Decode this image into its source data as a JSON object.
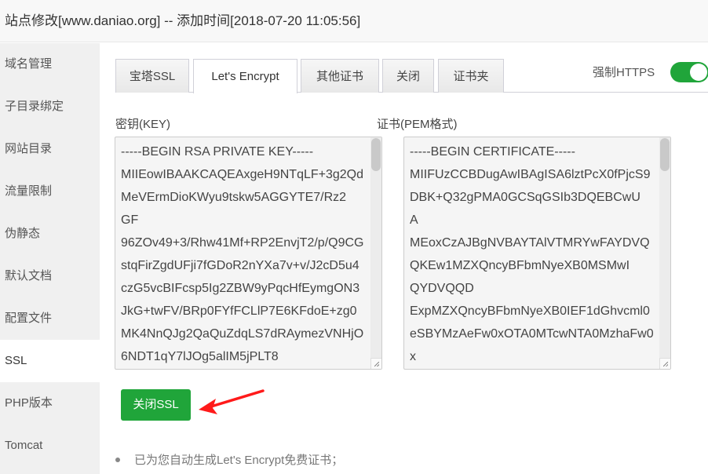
{
  "title_bar": {
    "text": "站点修改[www.daniao.org] -- 添加时间[2018-07-20 11:05:56]"
  },
  "sidebar": {
    "items": [
      {
        "label": "域名管理",
        "active": false
      },
      {
        "label": "子目录绑定",
        "active": false
      },
      {
        "label": "网站目录",
        "active": false
      },
      {
        "label": "流量限制",
        "active": false
      },
      {
        "label": "伪静态",
        "active": false
      },
      {
        "label": "默认文档",
        "active": false
      },
      {
        "label": "配置文件",
        "active": false
      },
      {
        "label": "SSL",
        "active": true
      },
      {
        "label": "PHP版本",
        "active": false
      },
      {
        "label": "Tomcat",
        "active": false
      }
    ]
  },
  "tabs": [
    {
      "label": "宝塔SSL",
      "active": false
    },
    {
      "label": "Let's Encrypt",
      "active": true
    },
    {
      "label": "其他证书",
      "active": false
    },
    {
      "label": "关闭",
      "active": false
    },
    {
      "label": "证书夹",
      "active": false
    }
  ],
  "force_https": {
    "label": "强制HTTPS",
    "enabled": true,
    "color": "#20a53a"
  },
  "key_field": {
    "label": "密钥(KEY)",
    "value": "-----BEGIN RSA PRIVATE KEY-----\nMIIEowIBAAKCAQEAxgeH9NTqLF+3g2QdMeVErmDioKWyu9tskw5AGGYTE7/Rz2\nGF\n96ZOv49+3/Rhw41Mf+RP2EnvjT2/p/Q9CGstqFirZgdUFji7fGDoR2nYXa7v+v/J2cD5u4czG5vcBIFcsp5Ig2ZBW9yPqcHfEymgON3JkG+twFV/BRp0FYfFCLlP7E6KFdoE+zg0MK4NnQJg2QaQuZdqLS7dRAymezVNHjO6NDT1qY7lJOg5alIM5jPLT8"
  },
  "cert_field": {
    "label": "证书(PEM格式)",
    "value": "-----BEGIN CERTIFICATE-----\nMIIFUzCCBDugAwIBAgISA6lztPcX0fPjcS9DBK+Q32gPMA0GCSqGSIb3DQEBCwU\nA\nMEoxCzAJBgNVBAYTAlVTMRYwFAYDVQQKEw1MZXQncyBFbmNyeXB0MSMwI\nQYDVQQD\nExpMZXQncyBFbmNyeXB0IEF1dGhvcml0eSBYMzAeFw0xOTA0MTcwNTA0MzhaFw0x"
  },
  "actions": {
    "close_ssl_label": "关闭SSL",
    "close_ssl_color": "#20a53a"
  },
  "annotation": {
    "arrow_color": "#ff1a1a"
  },
  "tips": [
    "已为您自动生成Let's Encrypt免费证书；"
  ]
}
